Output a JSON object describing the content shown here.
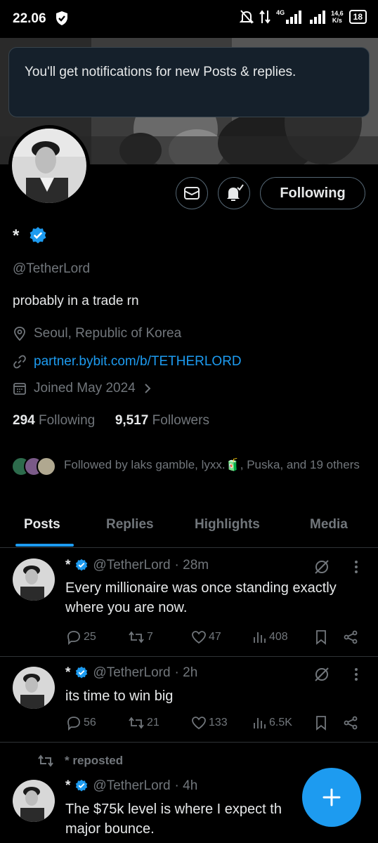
{
  "status_bar": {
    "time": "22.06",
    "speed_value": "14,6",
    "speed_unit": "K/s",
    "network": "4G",
    "battery": "18"
  },
  "toast": {
    "text": "You'll get notifications for new Posts & replies."
  },
  "profile": {
    "name": "*",
    "handle": "@TetherLord",
    "bio": "probably in a trade rn",
    "location": "Seoul, Republic of Korea",
    "website": "partner.bybit.com/b/TETHERLORD",
    "joined": "Joined May 2024",
    "following_count": "294",
    "following_label": "Following",
    "followers_count": "9,517",
    "followers_label": "Followers",
    "followed_by": "Followed by laks gamble, lyxx.🧃, Puska, and 19 others"
  },
  "actions": {
    "follow_label": "Following",
    "message_icon": "envelope-icon",
    "notify_icon": "bell-check-icon"
  },
  "tabs": [
    {
      "label": "Posts",
      "active": true
    },
    {
      "label": "Replies",
      "active": false
    },
    {
      "label": "Highlights",
      "active": false
    },
    {
      "label": "Media",
      "active": false
    }
  ],
  "posts": [
    {
      "name": "*",
      "handle": "@TetherLord",
      "time": "· 28m",
      "text": "Every millionaire was once standing exactly where you are now.",
      "replies": "25",
      "reposts": "7",
      "likes": "47",
      "views": "408"
    },
    {
      "name": "*",
      "handle": "@TetherLord",
      "time": "· 2h",
      "text": "its time to win big",
      "replies": "56",
      "reposts": "21",
      "likes": "133",
      "views": "6.5K"
    },
    {
      "repost_label": "* reposted",
      "name": "*",
      "handle": "@TetherLord",
      "time": "· 4h",
      "text": "The $75k level is where I expect th",
      "text_line2": "major bounce."
    }
  ],
  "colors": {
    "accent": "#1d9bf0",
    "background": "#000000",
    "muted": "#71767b",
    "text": "#e7e9ea"
  }
}
